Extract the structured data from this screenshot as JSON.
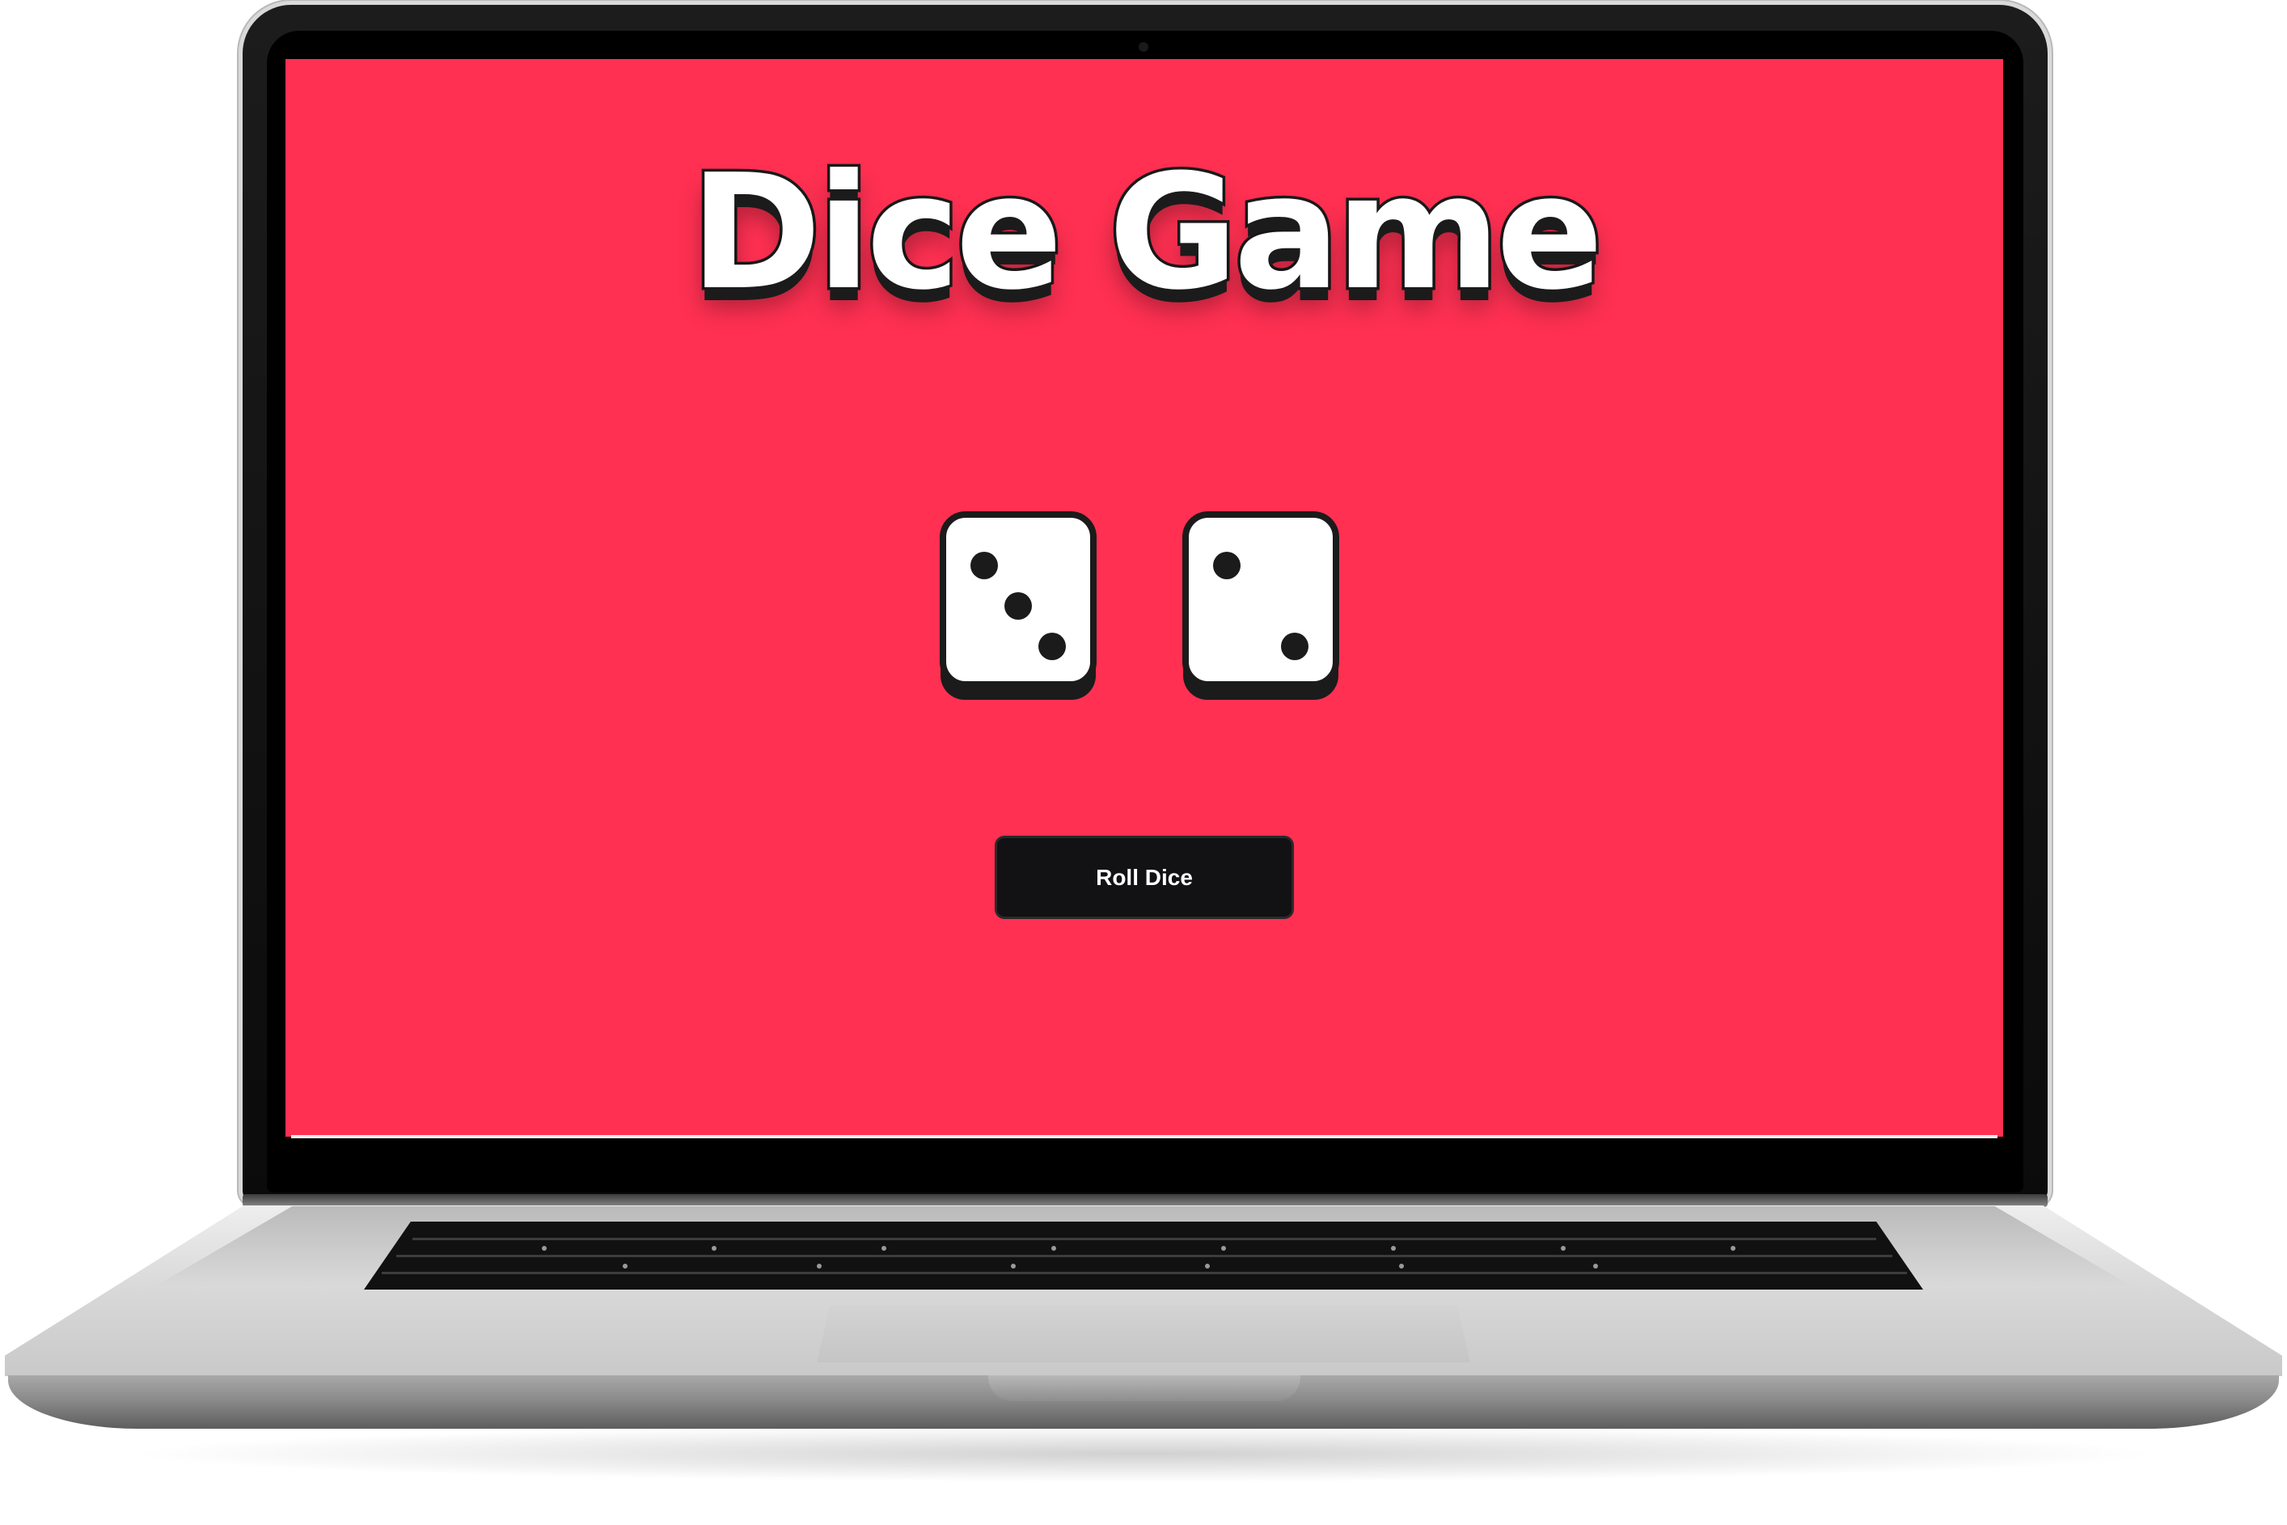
{
  "game": {
    "title": "Dice Game",
    "roll_button_label": "Roll Dice"
  },
  "dice": [
    {
      "value": 3
    },
    {
      "value": 2
    }
  ],
  "colors": {
    "background": "#ff3052",
    "button": "#121214",
    "button_text": "#ffffff",
    "die_face": "#ffffff",
    "die_outline": "#1b1b1b",
    "pip": "#1b1b1b"
  },
  "icons": {
    "die_1": "dice-face-three-icon",
    "die_2": "dice-face-two-icon"
  }
}
